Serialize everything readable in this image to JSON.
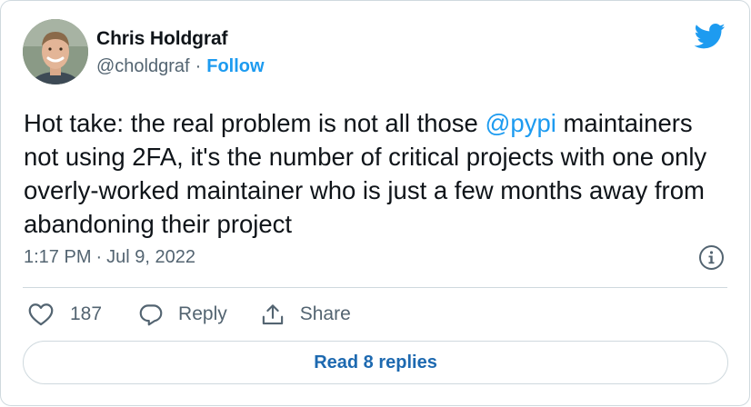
{
  "author": {
    "name": "Chris Holdgraf",
    "handle": "@choldgraf",
    "separator": "·",
    "follow_label": "Follow"
  },
  "tweet": {
    "text_before_mention": "Hot take: the real problem is not all those ",
    "mention": "@pypi",
    "text_after_mention": " maintainers not using 2FA, it's the number of critical projects with one only overly-worked maintainer who is just a few months away from abandoning their project",
    "time": "1:17 PM",
    "separator": "·",
    "date": "Jul 9, 2022"
  },
  "actions": {
    "like_count": "187",
    "reply_label": "Reply",
    "share_label": "Share"
  },
  "read_replies_label": "Read 8 replies",
  "colors": {
    "accent": "#1d9bf0",
    "text": "#0f1419",
    "muted": "#536471",
    "border": "#cfd9de"
  },
  "icons": {
    "brand": "twitter-bird-icon",
    "info": "info-icon",
    "like": "heart-icon",
    "reply": "speech-bubble-icon",
    "share": "share-upload-icon"
  }
}
